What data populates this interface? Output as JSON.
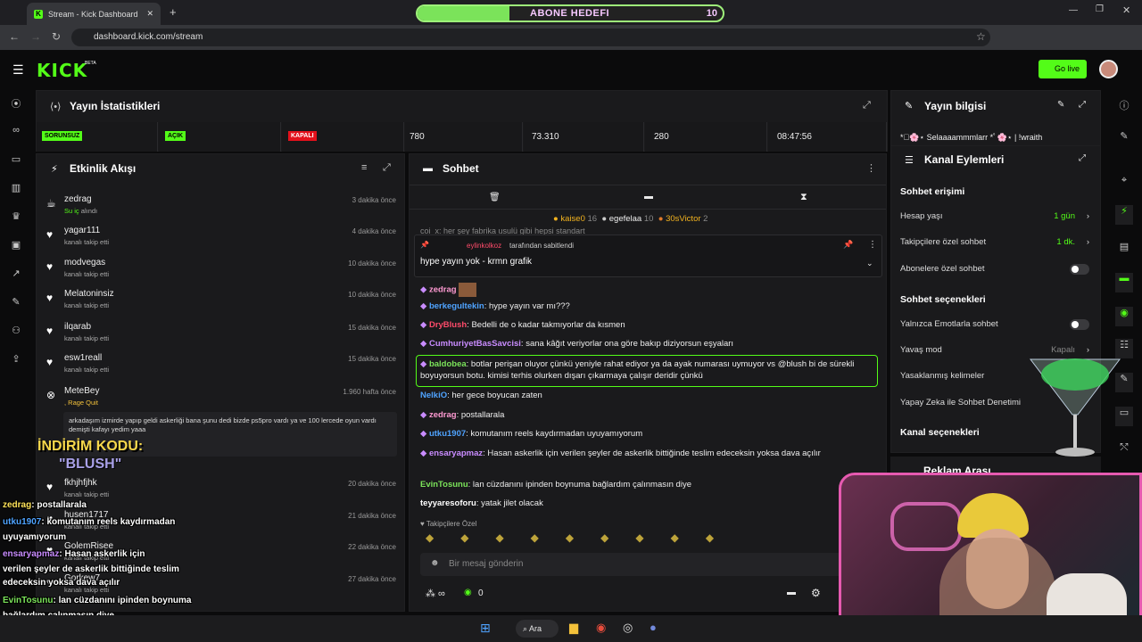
{
  "browser": {
    "tab_title": "Stream - Kick Dashboard",
    "url": "dashboard.kick.com/stream"
  },
  "goal": {
    "label": "ABONE HEDEFI",
    "value": "10",
    "progress": 0.3
  },
  "header": {
    "go_live": "Go live",
    "logo": "KICK",
    "beta": "BETA"
  },
  "stats": {
    "title": "Yayın İstatistikleri",
    "badges": [
      "SORUNSUZ",
      "AÇIK",
      "KAPALI"
    ],
    "values": [
      "780",
      "73.310",
      "280",
      "08:47:56"
    ]
  },
  "activity": {
    "title": "Etkinlik Akışı",
    "events": [
      {
        "name": "zedrag",
        "sub": "Su iç",
        "sub2": "alındı",
        "time": "3 dakika önce"
      },
      {
        "name": "yagar111",
        "sub": "kanalı takip etti",
        "time": "4 dakika önce"
      },
      {
        "name": "modvegas",
        "sub": "kanalı takip etti",
        "time": "10 dakika önce"
      },
      {
        "name": "Melatoninsiz",
        "sub": "kanalı takip etti",
        "time": "10 dakika önce"
      },
      {
        "name": "ilqarab",
        "sub": "kanalı takip etti",
        "time": "15 dakika önce"
      },
      {
        "name": "esw1reall",
        "sub": "kanalı takip etti",
        "time": "15 dakika önce"
      },
      {
        "name": "MeteBey",
        "sub": ", Rage Quit",
        "time": "1.960 hafta önce"
      },
      {
        "name": "fkhjhfjhk",
        "sub": "kanalı takip etti",
        "time": "20 dakika önce"
      },
      {
        "name": "husen1717",
        "sub": "kanalı takip etti",
        "time": "21 dakika önce"
      },
      {
        "name": "GolemRisee",
        "sub": "kanalı takip etti",
        "time": "22 dakika önce"
      },
      {
        "name": "Gorkew7",
        "sub": "kanalı takip etti",
        "time": "27 dakika önce"
      }
    ],
    "ragequit_text": "arkadaşım izmirde yapıp geldi askerliği bana şunu dedi bizde ps5pro vardı ya ve 100 lercede oyun vardı demişti kafayı yedim yaaa"
  },
  "overlay_promo": {
    "line1": "İNDİRİM KODU:",
    "line2": "\"BLUSH\""
  },
  "chat": {
    "title": "Sohbet",
    "leaders": [
      {
        "name": "kaise0",
        "n": "16"
      },
      {
        "name": "egefelaa",
        "n": "10"
      },
      {
        "name": "30sVictor",
        "n": "2"
      }
    ],
    "pinned_by": "eylinkolkoz",
    "pinned_suffix": "tarafından sabitlendi",
    "pinned_msg": "hype yayın yok - krmn grafik",
    "partial_line": "coi_x: her şey fabrika usulü gibi hepsi standart",
    "messages": [
      {
        "user": "zedrag",
        "color": "#ff9ad2",
        "text": ""
      },
      {
        "user": "berkegultekin",
        "color": "#4fa3ff",
        "text": ": hype yayın var mı???"
      },
      {
        "user": "DryBlush",
        "color": "#ff4b6a",
        "text": ": Bedelli de o kadar takmıyorlar da kısmen"
      },
      {
        "user": "CumhuriyetBasSavcisi",
        "color": "#c98cff",
        "text": ": sana kâğıt veriyorlar ona göre bakıp diziyorsun eşyaları"
      },
      {
        "user": "baldobea",
        "color": "#7be35a",
        "text": ": botlar perişan oluyor çünkü yeniyle rahat ediyor ya da ayak numarası uymuyor vs @blush bi de sürekli boyuyorsun botu. kimisi terhis olurken dışarı çıkarmaya çalışır deridir çünkü"
      },
      {
        "user": "NelkiO",
        "color": "#4fa3ff",
        "text": ": her gece boyucan zaten"
      },
      {
        "user": "zedrag",
        "color": "#ff9ad2",
        "text": ": postallarala"
      },
      {
        "user": "utku1907",
        "color": "#4fa3ff",
        "text": ": komutanım reels kaydırmadan uyuyamıyorum"
      },
      {
        "user": "ensaryapmaz",
        "color": "#c98cff",
        "text": ": Hasan askerlik için verilen şeyler de askerlik bittiğinde teslim edeceksin yoksa dava açılır"
      },
      {
        "user": "EvinTosunu",
        "color": "#7be35a",
        "text": ": lan cüzdanını ipinden boynuma bağlardım çalınmasın diye"
      },
      {
        "user": "teyyaresoforu",
        "color": "#ffffff",
        "text": ": yatak jilet olacak"
      }
    ],
    "followers_only": "Takipçilere Özel",
    "placeholder": "Bir mesaj gönderin",
    "points": "0"
  },
  "info": {
    "title": "Yayın bilgisi",
    "stream_title": "*ﾟ🌸⋆ Selaaaammmlarr *ﾟ🌸⋆ | !wraith"
  },
  "actions": {
    "title": "Kanal Eylemleri",
    "chat_access": "Sohbet erişimi",
    "account_age": "Hesap yaşı",
    "account_age_val": "1 gün",
    "followers_chat": "Takipçilere özel sohbet",
    "followers_chat_val": "1 dk.",
    "subs_chat": "Abonelere özel sohbet",
    "chat_options": "Sohbet seçenekleri",
    "emotes_only": "Yalnızca Emotlarla sohbet",
    "slow": "Yavaş mod",
    "slow_val": "Kapalı",
    "banned": "Yasaklanmış kelimeler",
    "ai": "Yapay Zeka ile Sohbet Denetimi",
    "channel_opts": "Kanal seçenekleri",
    "ad_break": "Reklam Arası"
  },
  "overlay_chat": [
    {
      "user": "zedrag",
      "color": "#ffe35a",
      "text": ": postallarala"
    },
    {
      "user": "utku1907",
      "color": "#4fa3ff",
      "text": ": komutanım reels kaydırmadan"
    },
    {
      "user": "",
      "color": "#fff",
      "text": "uyuyamıyorum"
    },
    {
      "user": "ensaryapmaz",
      "color": "#c98cff",
      "text": ": Hasan askerlik için"
    },
    {
      "user": "",
      "color": "#fff",
      "text": "verilen şeyler de askerlik bittiğinde teslim"
    },
    {
      "user": "",
      "color": "#fff",
      "text": "edeceksin yoksa dava açılır"
    },
    {
      "user": "EvinTosunu",
      "color": "#7be35a",
      "text": ": lan cüzdanını ipinden boynuma"
    },
    {
      "user": "",
      "color": "#fff",
      "text": "bağlardım çalınmasın diye"
    },
    {
      "user": "teyyaresoforu",
      "color": "#fff",
      "text": ": yatak jilet olacak"
    }
  ],
  "taskbar": {
    "search": "Ara"
  }
}
